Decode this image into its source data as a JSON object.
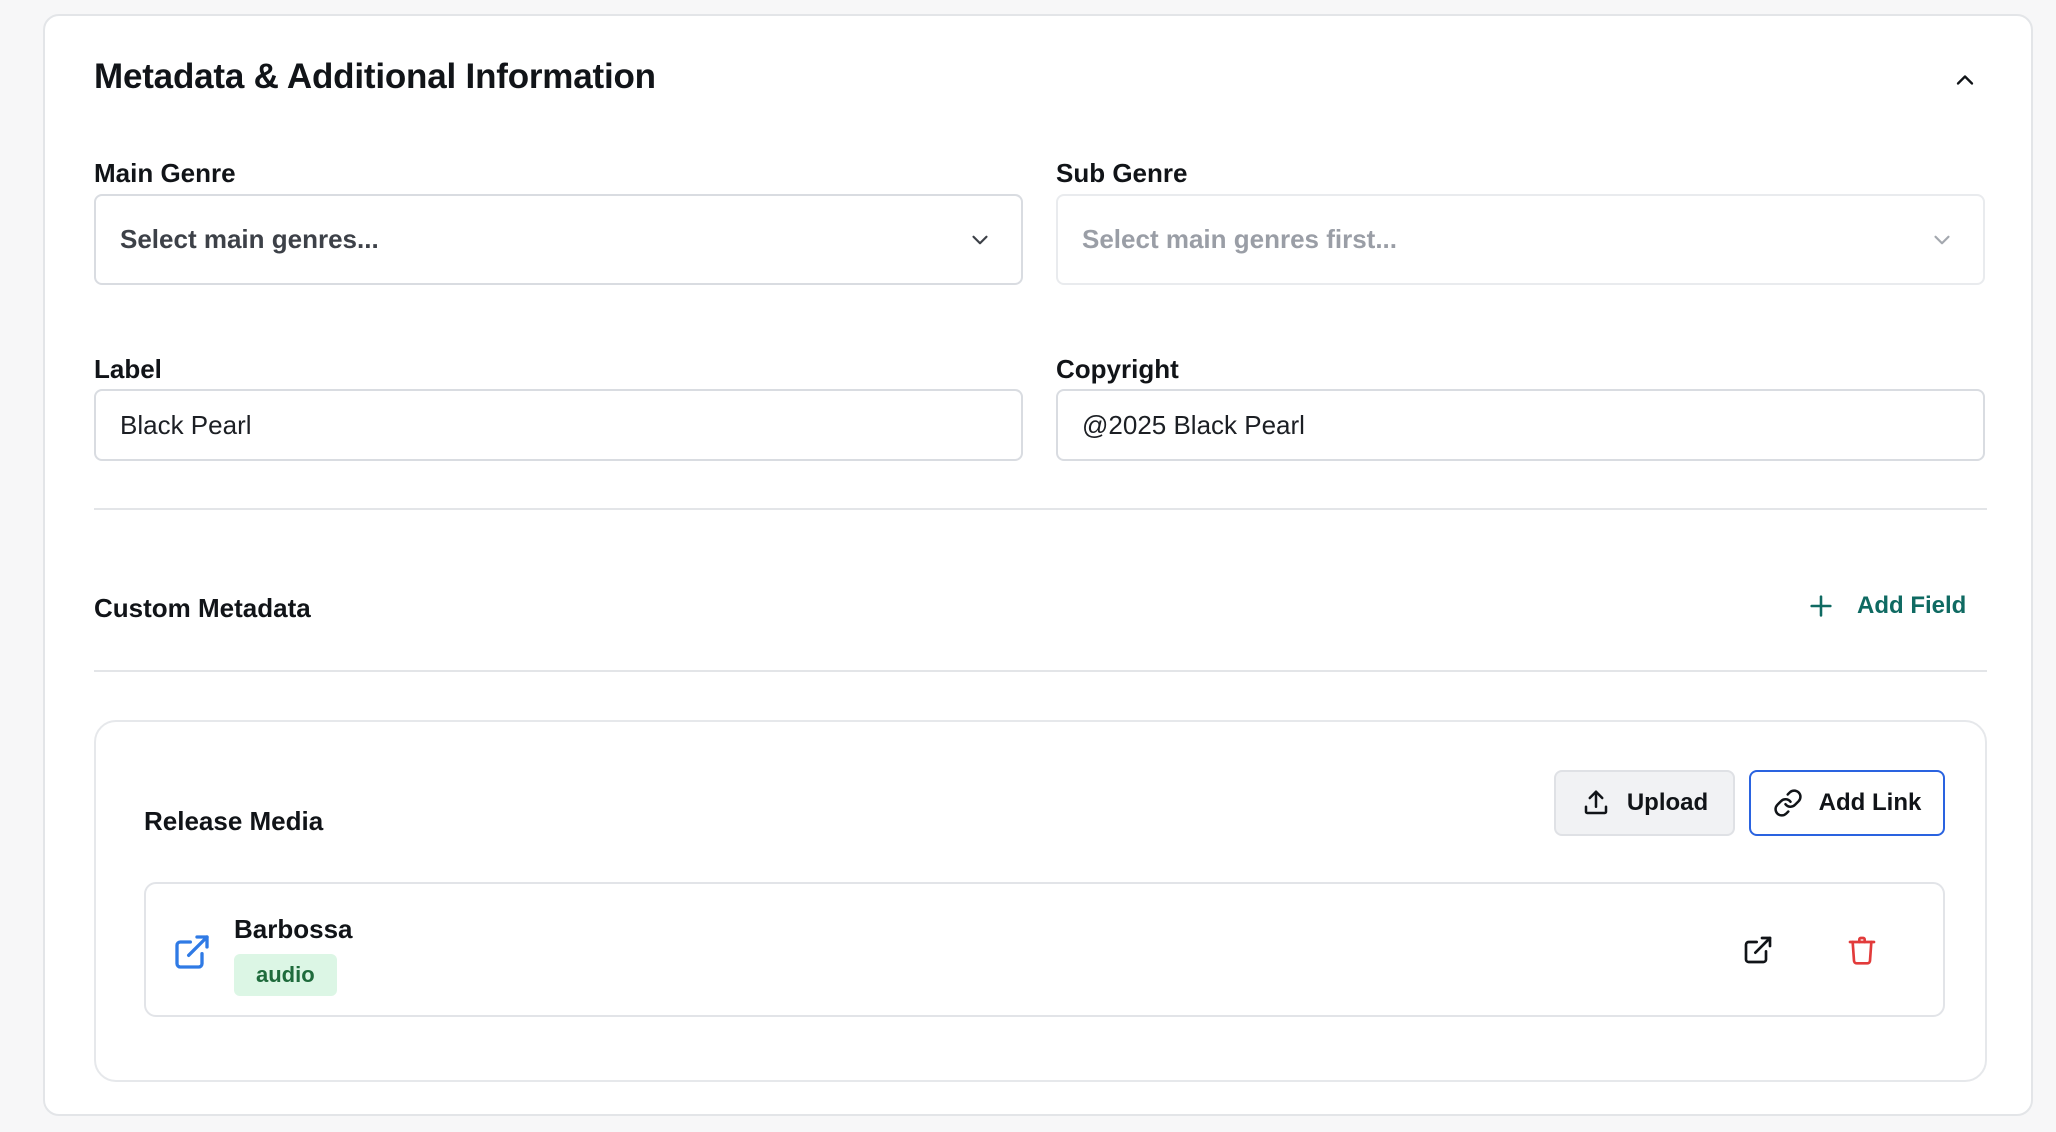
{
  "section": {
    "title": "Metadata & Additional Information"
  },
  "fields": {
    "main_genre": {
      "label": "Main Genre",
      "placeholder": "Select main genres..."
    },
    "sub_genre": {
      "label": "Sub Genre",
      "placeholder": "Select main genres first..."
    },
    "label": {
      "label": "Label",
      "value": "Black Pearl"
    },
    "copyright": {
      "label": "Copyright",
      "value": "@2025 Black Pearl"
    }
  },
  "custom_metadata": {
    "title": "Custom Metadata",
    "add_field_label": "Add Field"
  },
  "release_media": {
    "title": "Release Media",
    "upload_label": "Upload",
    "add_link_label": "Add Link",
    "items": [
      {
        "name": "Barbossa",
        "type": "audio"
      }
    ]
  },
  "colors": {
    "accent_teal": "#0f6a62",
    "primary_blue": "#2a63e0",
    "link_icon_blue": "#2f7ae5",
    "danger_red": "#e23b3b",
    "badge_bg": "#dcf6e5",
    "badge_text": "#1f6b3c"
  },
  "icons": {
    "collapse": "chevron-up-icon",
    "select": "chevron-down-icon",
    "add": "plus-icon",
    "upload": "upload-icon",
    "link": "link-icon",
    "external": "external-link-icon",
    "delete": "trash-icon"
  }
}
